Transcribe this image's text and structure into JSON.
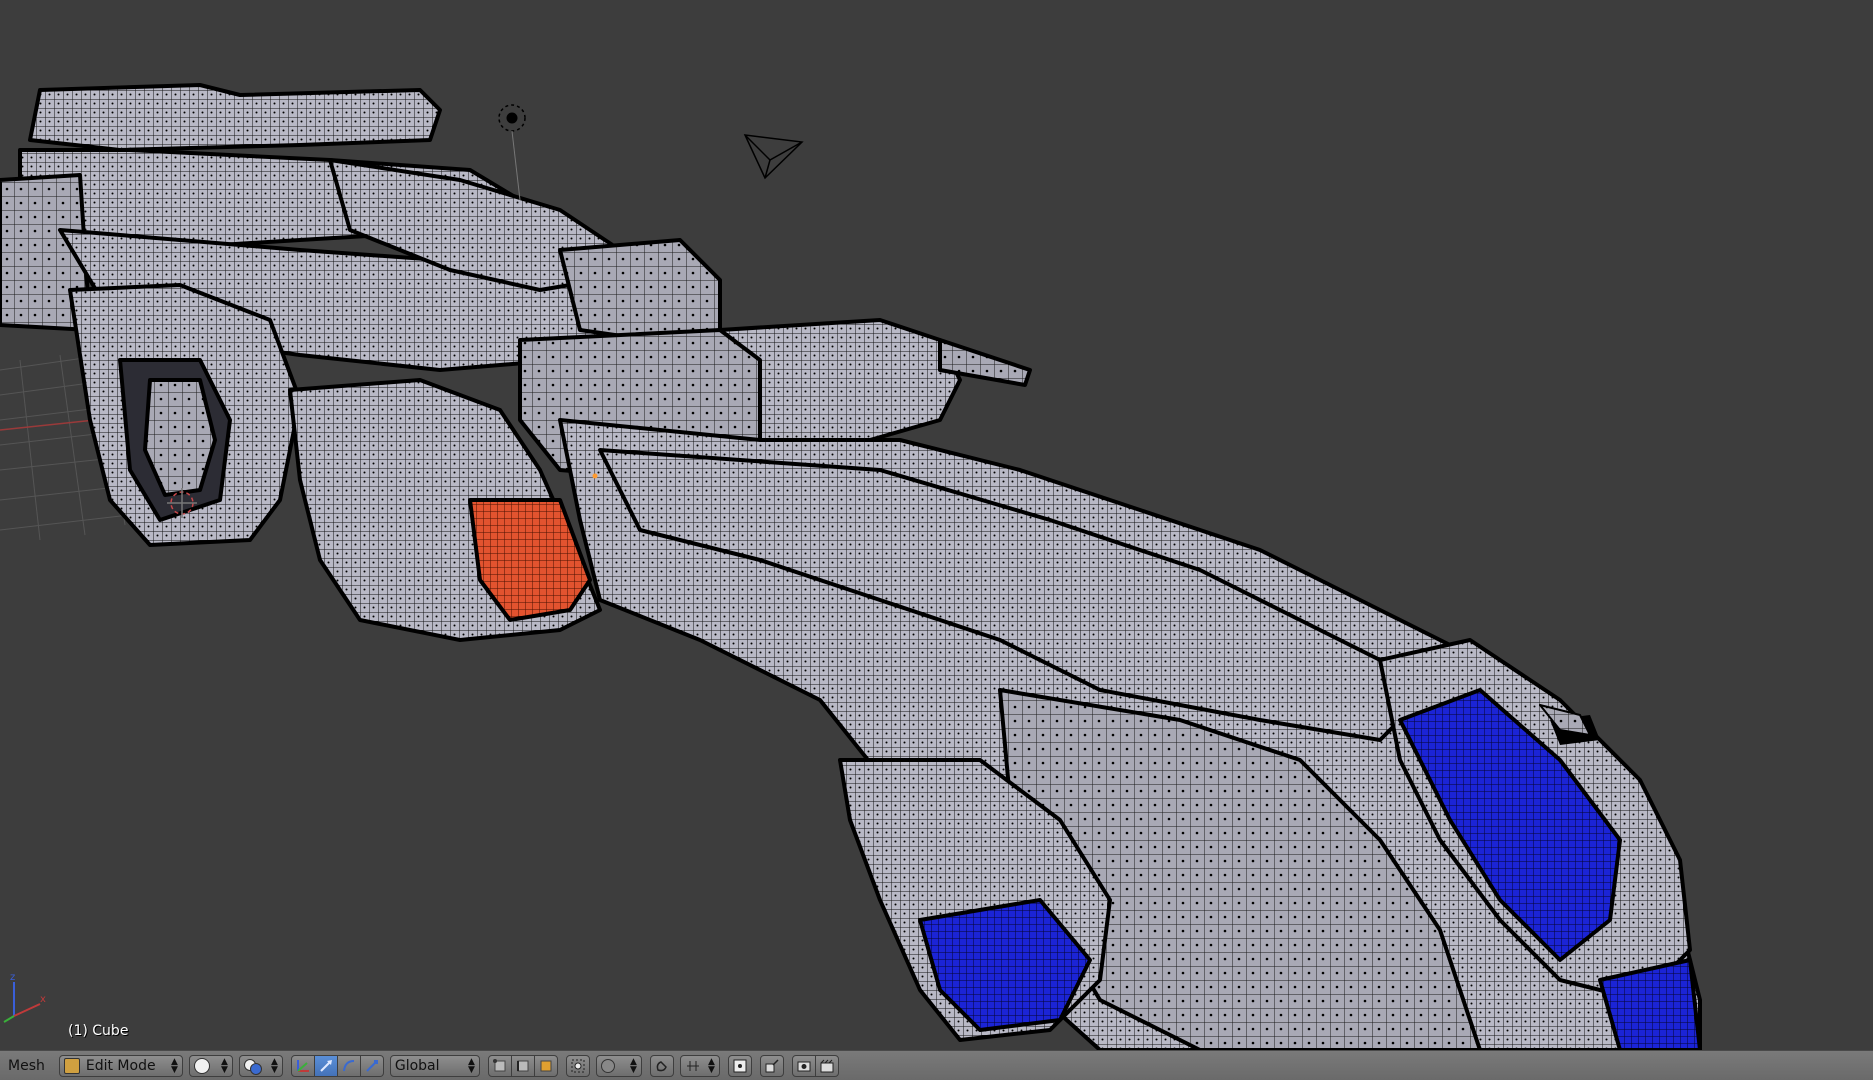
{
  "viewport": {
    "object_label": "(1) Cube",
    "background": "#3d3d3d",
    "mesh_face_color": "#b8b8c4",
    "wire_color": "#000000",
    "selected_blue": "#1a2bd0",
    "selected_orange": "#e0502c"
  },
  "header": {
    "menu_mesh": "Mesh",
    "mode_dropdown": "Edit Mode",
    "orientation_dropdown": "Global",
    "icons": [
      "mode-icon",
      "viewport-shading-icon",
      "pivot-icon",
      "manipulator-translate-icon",
      "manipulator-rotate-icon",
      "manipulator-scale-icon",
      "vertex-select-icon",
      "edge-select-icon",
      "face-select-icon",
      "limit-selection-icon",
      "proportional-edit-icon",
      "snap-icon",
      "snap-target-icon",
      "render-icon",
      "render-anim-icon"
    ],
    "accent_active": "#5a8fd8"
  }
}
